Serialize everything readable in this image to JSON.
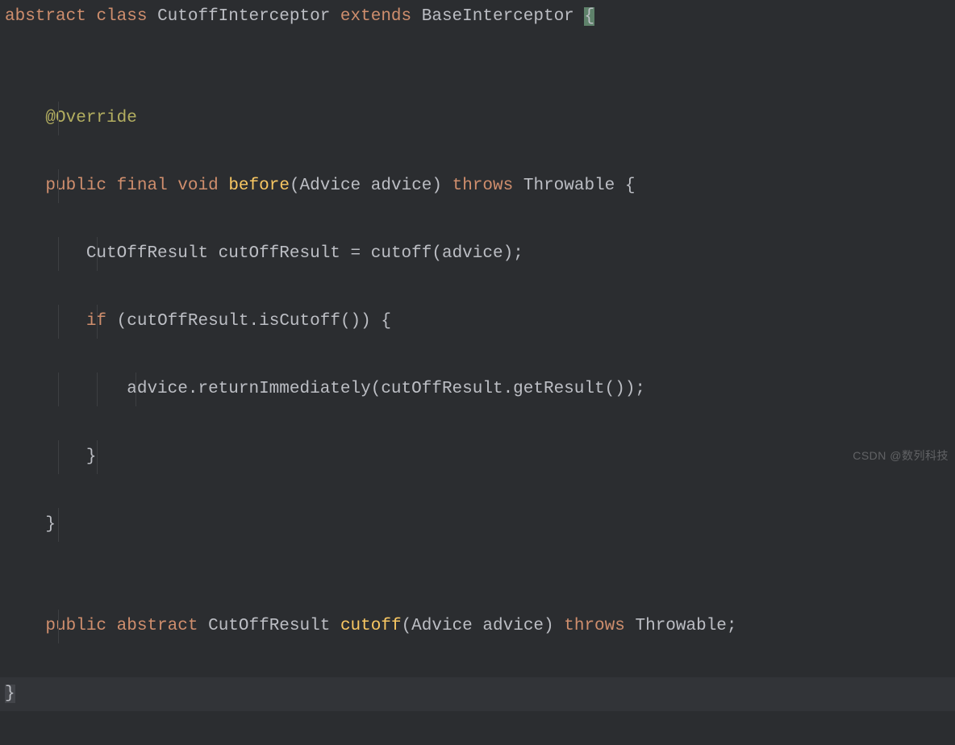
{
  "code": {
    "line1": {
      "kw_abstract": "abstract",
      "kw_class": "class",
      "classname": "CutoffInterceptor",
      "kw_extends": "extends",
      "superclass": "BaseInterceptor",
      "brace_open": "{"
    },
    "blank1": "",
    "line3": {
      "annotation": "@Override"
    },
    "line4": {
      "kw_public": "public",
      "kw_final": "final",
      "kw_void": "void",
      "method": "before",
      "paren_open": "(",
      "param_type": "Advice",
      "param_name": "advice",
      "paren_close": ")",
      "kw_throws": "throws",
      "throws_type": "Throwable",
      "brace_open": "{"
    },
    "line5": {
      "type": "CutOffResult",
      "var": "cutOffResult",
      "eq": "=",
      "call": "cutoff",
      "paren_open": "(",
      "arg": "advice",
      "paren_close": ")",
      "semi": ";"
    },
    "line6": {
      "kw_if": "if",
      "paren_open": "(",
      "obj": "cutOffResult",
      "dot": ".",
      "method": "isCutoff",
      "call_parens": "()",
      "paren_close": ")",
      "brace_open": "{"
    },
    "line7": {
      "obj": "advice",
      "dot1": ".",
      "method1": "returnImmediately",
      "paren_open": "(",
      "arg_obj": "cutOffResult",
      "dot2": ".",
      "method2": "getResult",
      "call_parens": "()",
      "paren_close": ")",
      "semi": ";"
    },
    "line8": {
      "brace_close": "}"
    },
    "line9": {
      "brace_close": "}"
    },
    "blank2": "",
    "line11": {
      "kw_public": "public",
      "kw_abstract": "abstract",
      "ret_type": "CutOffResult",
      "method": "cutoff",
      "paren_open": "(",
      "param_type": "Advice",
      "param_name": "advice",
      "paren_close": ")",
      "kw_throws": "throws",
      "throws_type": "Throwable",
      "semi": ";"
    },
    "line12": {
      "brace_close": "}"
    }
  },
  "watermark": "CSDN @数列科技"
}
